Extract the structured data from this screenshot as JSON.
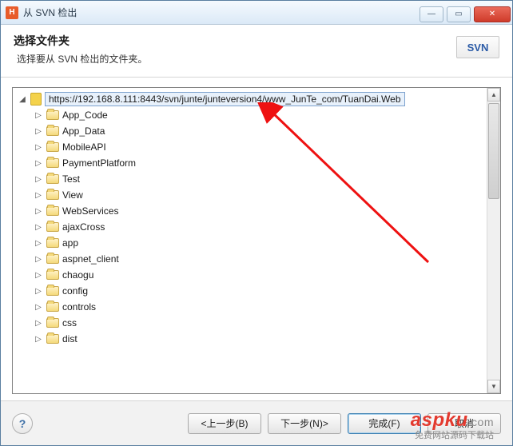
{
  "window": {
    "title": "从 SVN 检出",
    "app_icon_letter": "H"
  },
  "header": {
    "title": "选择文件夹",
    "subtitle": "选择要从 SVN 检出的文件夹。",
    "badge_label": "SVN"
  },
  "tree": {
    "root": {
      "url": "https://192.168.8.111:8443/svn/junte/junteversion4/www_JunTe_com/TuanDai.Web",
      "icon": "repo-icon",
      "expanded": true
    },
    "items": [
      {
        "name": "App_Code"
      },
      {
        "name": "App_Data"
      },
      {
        "name": "MobileAPI"
      },
      {
        "name": "PaymentPlatform"
      },
      {
        "name": "Test"
      },
      {
        "name": "View"
      },
      {
        "name": "WebServices"
      },
      {
        "name": "ajaxCross"
      },
      {
        "name": "app"
      },
      {
        "name": "aspnet_client"
      },
      {
        "name": "chaogu"
      },
      {
        "name": "config"
      },
      {
        "name": "controls"
      },
      {
        "name": "css"
      },
      {
        "name": "dist"
      }
    ]
  },
  "footer": {
    "help": "?",
    "back": "<上一步(B)",
    "next": "下一步(N)>",
    "finish": "完成(F)",
    "cancel": "取消"
  },
  "watermark": {
    "brand": "aspku",
    "suffix": ".com",
    "tagline": "免费网站源码下载站"
  }
}
